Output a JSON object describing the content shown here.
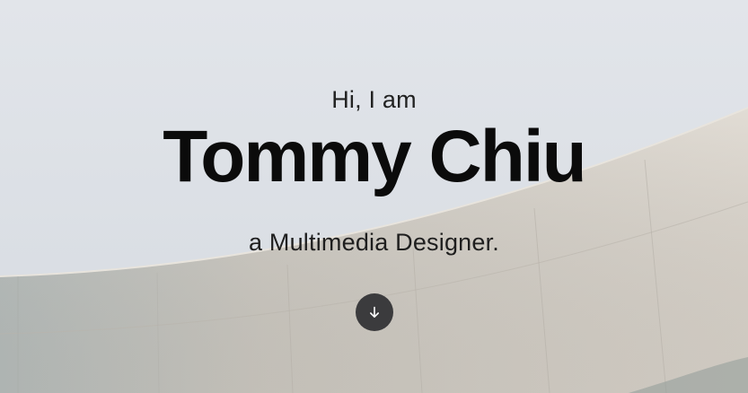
{
  "hero": {
    "intro": "Hi, I am",
    "name": "Tommy Chiu",
    "tagline": "a Multimedia Designer.",
    "scroll_icon": "arrow-down-icon"
  },
  "colors": {
    "sky": "#dfe3e8",
    "wall": "#d2ccc3",
    "button": "#3b3b3d",
    "text": "#0b0b0b"
  }
}
